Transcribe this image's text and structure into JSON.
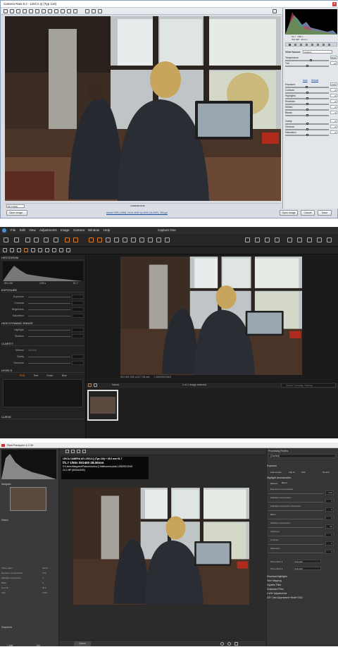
{
  "acr": {
    "title": "Camera Raw 9.2 - LEICA Q (Typ 116)",
    "histogram_readout": "f/1.7   1/50 s\nISO 400   28 mm",
    "white_balance_label": "White Balance:",
    "white_balance_value": "Custom",
    "auto_label": "Auto",
    "default_label": "Default",
    "sliders": [
      {
        "label": "Temperature",
        "value": "5100"
      },
      {
        "label": "Tint",
        "value": "+2"
      },
      {
        "label": "Exposure",
        "value": "-0.05"
      },
      {
        "label": "Contrast",
        "value": "0"
      },
      {
        "label": "Highlights",
        "value": "0"
      },
      {
        "label": "Shadows",
        "value": "0"
      },
      {
        "label": "Whites",
        "value": "0"
      },
      {
        "label": "Blacks",
        "value": "0"
      },
      {
        "label": "Clarity",
        "value": "0"
      },
      {
        "label": "Vibrance",
        "value": "0"
      },
      {
        "label": "Saturation",
        "value": "0"
      }
    ],
    "slider_levels": [
      0.58,
      0.5,
      0.49,
      0.5,
      0.5,
      0.5,
      0.5,
      0.5,
      0.5,
      0.5,
      0.5
    ],
    "zoom": "Fit in View",
    "filename_bar": "L1000293.DNG",
    "info_link": "Adobe RGB (1998); 16 bit; 6000 by 4000 (24.0MP); 300 ppi",
    "save_image": "Save Image...",
    "open_image": "Open Image",
    "cancel": "Cancel",
    "done": "Done"
  },
  "c1": {
    "menu": [
      "File",
      "Edit",
      "View",
      "Adjustments",
      "Image",
      "Camera",
      "Window",
      "Help"
    ],
    "app_title": "Capture One",
    "histogram_title": "HISTOGRAM",
    "histo_readout": [
      "ISO 400",
      "1/50 s",
      "f/1.7"
    ],
    "exposure_title": "EXPOSURE",
    "exposure_rows": [
      "Exposure",
      "Contrast",
      "Brightness",
      "Saturation"
    ],
    "hdr_title": "HIGH DYNAMIC RANGE",
    "hdr_rows": [
      "Highlight",
      "Shadow"
    ],
    "clarity_title": "CLARITY",
    "clarity_method_label": "Method",
    "clarity_method_value": "Neutral",
    "clarity_rows": [
      "Clarity",
      "Structure"
    ],
    "levels_title": "LEVELS",
    "levels_tabs": [
      "RGB",
      "Red",
      "Green",
      "Blue"
    ],
    "curve_title": "CURVE",
    "photo_info": "ISO 400  1/50 s  f/1.7  28 mm",
    "photo_name": "L1000293.DNG",
    "browser_sort": "Name",
    "browser_count": "1 of 1 image selected",
    "browser_search_placeholder": "Search Thursday, Cleanup",
    "accent": "#e07a1f"
  },
  "rt": {
    "title": "RawTherapee 4.2.30",
    "overlay_line1": "LEICA CAMERA AG LEICA Q (Typ 116) + 28.0 mm f/1.7",
    "overlay_line2": "f/1.7  1/50s  ISO400  28.00mm",
    "overlay_line3": "D:\\Users\\Margaret\\Pictures\\Leica Q Melbourne pics\\L1000293.DNG",
    "overlay_line4": "24.1 MP (6000x4000)",
    "profile_title": "Processing Profiles",
    "profile_value": "(Cached)",
    "exposure_title": "Exposure",
    "tab_labels": [
      "Auto Levels",
      "Clip %",
      "0.00",
      "Neutral"
    ],
    "highlight_title": "Highlight reconstruction",
    "method_label": "Method",
    "method_value": "Blend",
    "rows": [
      {
        "label": "Exposure compensation",
        "value": "0.00"
      },
      {
        "label": "Highlight compression",
        "value": "0"
      },
      {
        "label": "Highlight compression threshold",
        "value": "0"
      },
      {
        "label": "Black",
        "value": "0"
      },
      {
        "label": "Shadow compression",
        "value": "50"
      },
      {
        "label": "Lightness",
        "value": "0"
      },
      {
        "label": "Contrast",
        "value": "0"
      },
      {
        "label": "Saturation",
        "value": "0"
      }
    ],
    "curve1_label": "Tone curve 1",
    "curve2_label": "Tone curve 2",
    "curve_mode": "Standard",
    "sections": [
      "Shadows/Highlights",
      "Tone Mapping",
      "Vignette Filter",
      "Graduated Filter",
      "L*a*b* Adjustments",
      "CIE Color Appearance Model 2002"
    ],
    "nav_rows": [
      [
        "Photo maker",
        "LEICA"
      ],
      [
        "Exposure compensation",
        "0.00"
      ],
      [
        "Highlight compression",
        "0"
      ],
      [
        "Black",
        "0"
      ],
      [
        "Lens ID",
        "28.0"
      ],
      [
        "Shot",
        "1/50s"
      ]
    ],
    "history_label": "History",
    "snapshots_label": "Snapshots",
    "add_label": "+ Add",
    "del_label": "- Del",
    "queue_label": "Queue",
    "panel_label": "Navigator"
  }
}
